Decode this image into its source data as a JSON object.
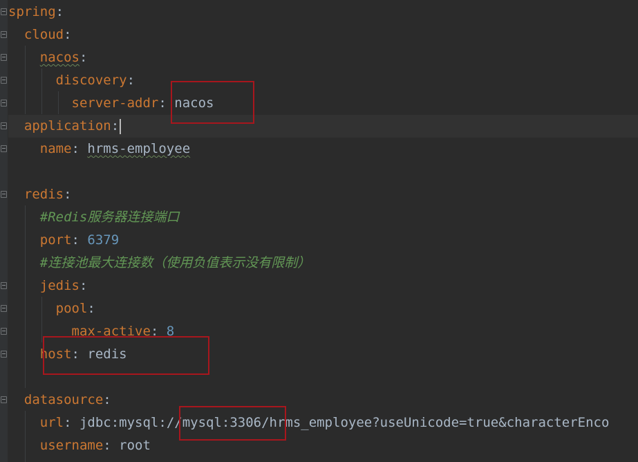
{
  "editor": {
    "lines": [
      {
        "indent": "",
        "key": "spring",
        "sep": ":"
      },
      {
        "indent": "  ",
        "key": "cloud",
        "sep": ":"
      },
      {
        "indent": "    ",
        "key": "nacos",
        "sep": ":"
      },
      {
        "indent": "      ",
        "key": "discovery",
        "sep": ":"
      },
      {
        "indent": "        ",
        "key": "server-addr",
        "sep": ": ",
        "value": "nacos"
      },
      {
        "indent": "  ",
        "key": "application",
        "sep": ":"
      },
      {
        "indent": "    ",
        "key": "name",
        "sep": ": ",
        "value": "hrms-employee"
      },
      {
        "indent": "",
        "key": "",
        "sep": ""
      },
      {
        "indent": "  ",
        "key": "redis",
        "sep": ":"
      },
      {
        "indent": "    ",
        "comment": "#Redis服务器连接端口"
      },
      {
        "indent": "    ",
        "key": "port",
        "sep": ": ",
        "value": "6379"
      },
      {
        "indent": "    ",
        "comment": "#连接池最大连接数（使用负值表示没有限制）"
      },
      {
        "indent": "    ",
        "key": "jedis",
        "sep": ":"
      },
      {
        "indent": "      ",
        "key": "pool",
        "sep": ":"
      },
      {
        "indent": "        ",
        "key": "max-active",
        "sep": ": ",
        "value": "8"
      },
      {
        "indent": "    ",
        "key": "host",
        "sep": ": ",
        "value": "redis"
      },
      {
        "indent": "",
        "key": "",
        "sep": ""
      },
      {
        "indent": "  ",
        "key": "datasource",
        "sep": ":"
      },
      {
        "indent": "    ",
        "key": "url",
        "sep": ": ",
        "value": "jdbc:mysql://mysql:3306/hrms_employee?useUnicode=true&characterEnco"
      },
      {
        "indent": "    ",
        "key": "username",
        "sep": ": ",
        "value": "root"
      }
    ]
  },
  "colors": {
    "background": "#2b2b2b",
    "key": "#cc7832",
    "number": "#6897bb",
    "comment": "#629755",
    "text": "#a9b7c6",
    "highlight_box": "#a8161d"
  }
}
